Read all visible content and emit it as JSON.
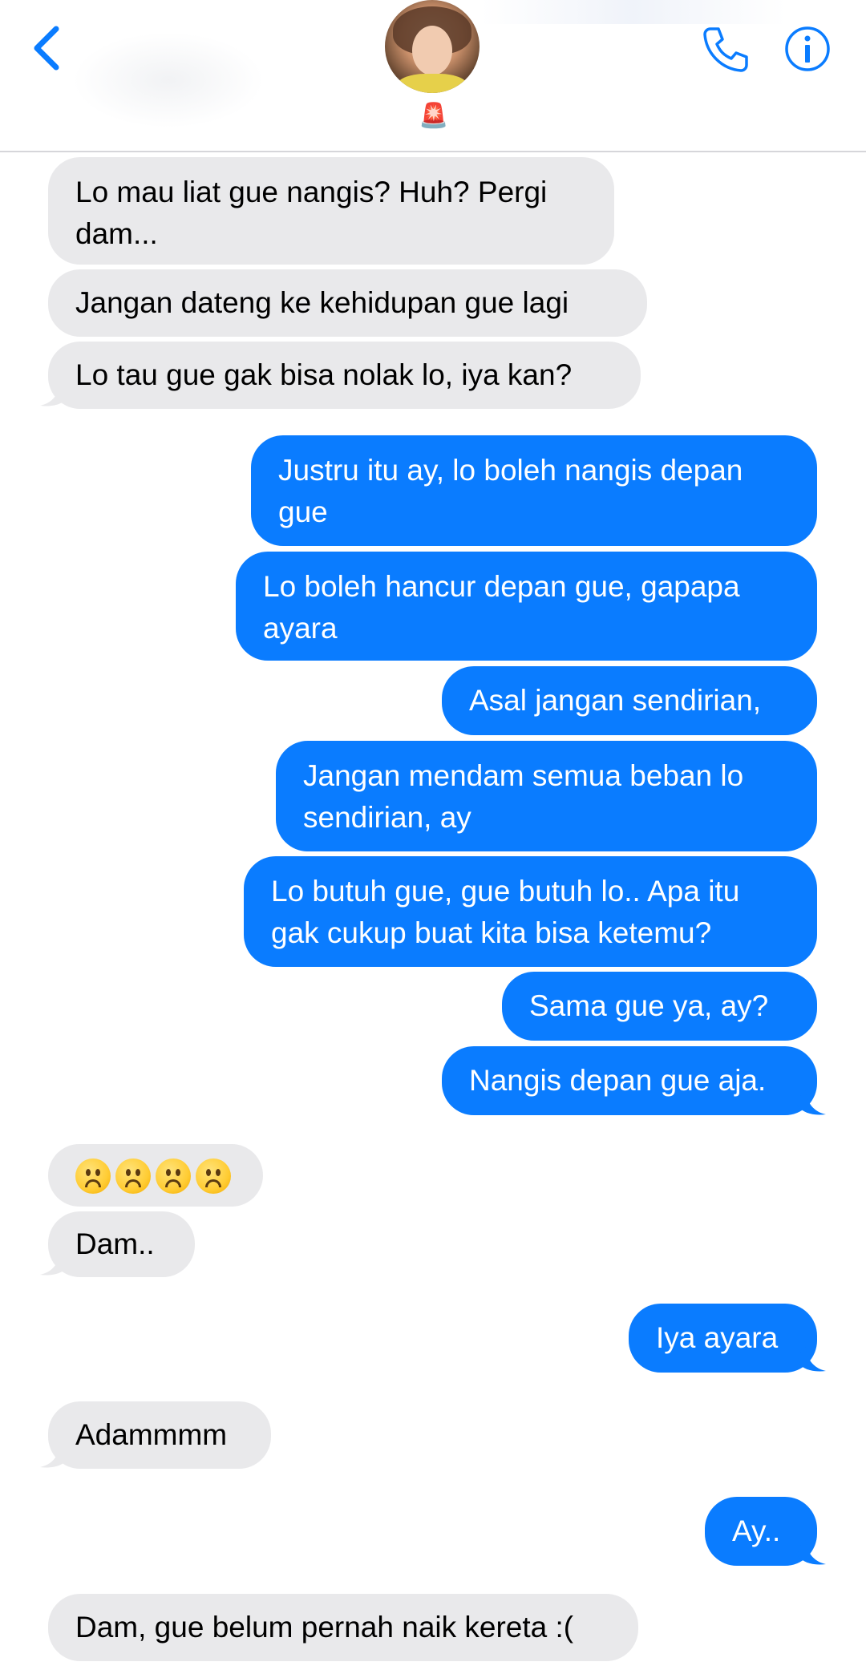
{
  "header": {
    "back_icon": "chevron-left-icon",
    "call_icon": "phone-icon",
    "info_icon": "info-icon",
    "name_emoji": "🚨",
    "accent_color": "#0a7cff"
  },
  "messages": [
    {
      "side": "received",
      "text": "Lo mau liat gue nangis? Huh? Pergi\ndam..."
    },
    {
      "side": "received",
      "text": "Jangan dateng ke kehidupan gue lagi"
    },
    {
      "side": "received",
      "text": "Lo tau gue gak bisa nolak lo, iya kan?"
    },
    {
      "side": "sent",
      "text": "Justru itu ay, lo boleh nangis depan\ngue"
    },
    {
      "side": "sent",
      "text": "Lo boleh hancur depan gue, gapapa\nayara"
    },
    {
      "side": "sent",
      "text": "Asal jangan sendirian,"
    },
    {
      "side": "sent",
      "text": "Jangan mendam semua beban lo\nsendirian, ay"
    },
    {
      "side": "sent",
      "text": "Lo butuh gue, gue butuh lo.. Apa itu\ngak cukup buat kita bisa ketemu?"
    },
    {
      "side": "sent",
      "text": "Sama gue ya, ay?"
    },
    {
      "side": "sent",
      "text": "Nangis depan gue aja."
    },
    {
      "side": "received",
      "text": "☹️☹️☹️☹️",
      "emoji_only": true
    },
    {
      "side": "received",
      "text": "Dam.."
    },
    {
      "side": "sent",
      "text": "Iya ayara"
    },
    {
      "side": "received",
      "text": "Adammmm"
    },
    {
      "side": "sent",
      "text": "Ay.."
    },
    {
      "side": "received",
      "text": "Dam, gue belum pernah naik kereta :("
    }
  ]
}
